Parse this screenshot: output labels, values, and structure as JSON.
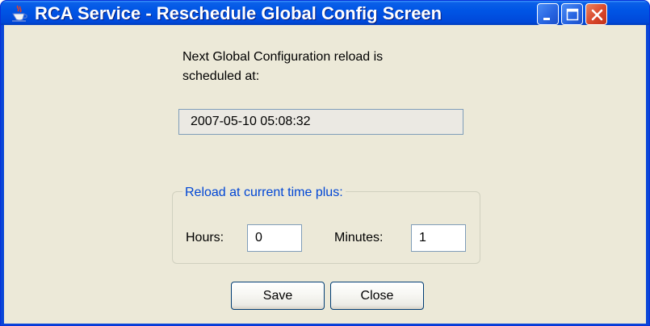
{
  "window": {
    "title": "RCA Service - Reschedule Global Config Screen",
    "icon": "java-cup-icon",
    "controls": [
      "minimize",
      "maximize",
      "close"
    ]
  },
  "message": {
    "line1": "Next Global Configuration reload is",
    "line2": "scheduled at:"
  },
  "next_reload": "2007-05-10 05:08:32",
  "group": {
    "legend": "Reload at current time plus:",
    "hours_label": "Hours:",
    "hours_value": "0",
    "minutes_label": "Minutes:",
    "minutes_value": "1"
  },
  "buttons": {
    "save": "Save",
    "close": "Close"
  },
  "colors": {
    "titlebar": "#0055e5",
    "client_bg": "#ece9d8",
    "legend_text": "#0046d5",
    "close_button": "#d9472b"
  }
}
